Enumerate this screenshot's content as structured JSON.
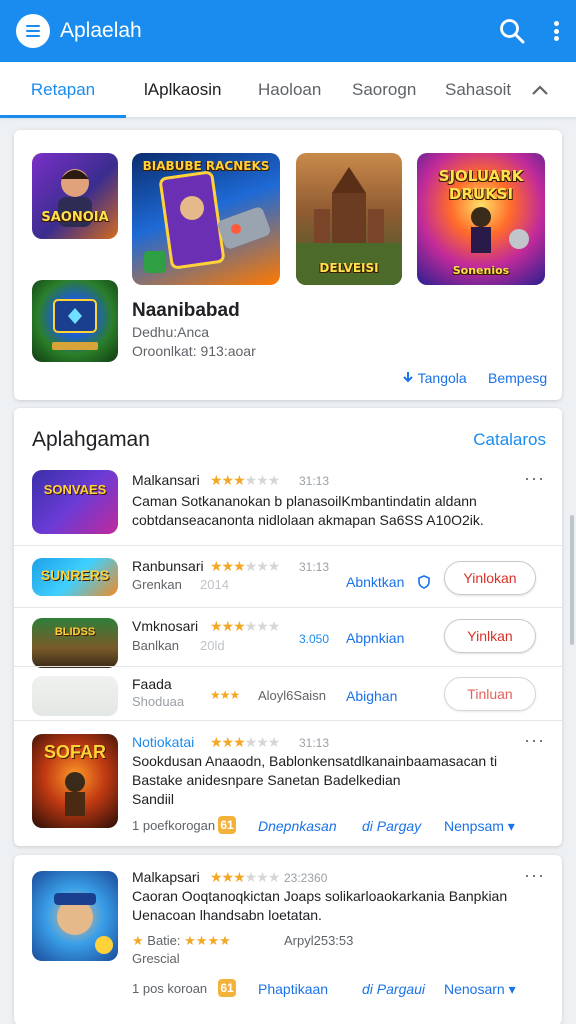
{
  "appbar": {
    "title": "Aplaelah",
    "icons": [
      "menu-icon",
      "search-icon",
      "more-vert-icon"
    ],
    "color": "#1a8cf0"
  },
  "tabs": [
    {
      "label": "Retapan",
      "active": true
    },
    {
      "label": "lAplkaosin"
    },
    {
      "label": "Haoloan"
    },
    {
      "label": "Saorogn"
    },
    {
      "label": "Sahasoit"
    }
  ],
  "featured": {
    "thumbs": [
      "SAONOIA",
      "BIABUBE RACNEKS",
      "DELVEISI",
      "SJOLUARK DRUKSI",
      ""
    ],
    "subcaption": "Sonenios",
    "title": "Naanibabad",
    "line1": "Dedhu:Anca",
    "line2": "Oroonlkat: 913:aoar",
    "link_left": "Tangola",
    "link_right": "Bempesg"
  },
  "section": {
    "title": "Aplahgaman",
    "link": "Catalaros",
    "items": [
      {
        "name": "Malkansari",
        "rating": "31:13",
        "stars": 3,
        "desc1": "Caman Sotkananokan b planasoilKmbantindatin aldann",
        "desc2": "cobtdanseacanonta nidlolaan akmapan Sa6SS A10O2ik.",
        "icon_text": "SONVAES"
      },
      {
        "name": "Ranbunsari",
        "rating": "31:13",
        "stars": 3,
        "meta": "Grenkan",
        "meta2": "2014",
        "link": "Abnktkan",
        "button": "Yinlokan",
        "icon_text": "SUNRERS"
      },
      {
        "name": "Vmknosari",
        "rating": "3.050",
        "stars": 3,
        "meta": "Banlkan",
        "meta2": "20ld",
        "link": "Abpnkian",
        "button": "Yinlkan",
        "icon_text": "BLIDSS"
      },
      {
        "name": "Faada",
        "stars": 3,
        "meta": "Shoduaa",
        "meta2": "Aloyl6Saisn",
        "link": "Abighan",
        "button": "Tinluan"
      },
      {
        "name": "Notiokatai",
        "rating": "31:13",
        "stars": 3,
        "desc1": "Sookdusan Anaaodn, Bablonkensatdlkanainbaamasacan ti",
        "desc2": "Bastake anidesnpare Sanetan Badelkedian",
        "desc3": "Sandiil",
        "meta": "1 poefkorogan",
        "badge": "61",
        "links": [
          "Dnepnkasan",
          "di Pargay",
          "Nenpsam"
        ],
        "icon_text": "SOFAR"
      }
    ]
  },
  "bottom_item": {
    "name": "Malkapsari",
    "rating": "23:2360",
    "stars": 3,
    "desc1": "Caoran Ooqtanoqkictan Joaps solikarloaokarkania Banpkian",
    "desc2": "Uenacoan lhandsabn loetatan.",
    "sub_label": "Batie:",
    "sub_value": "Arpyl253:53",
    "extra": "Grescial",
    "meta": "1 pos koroan",
    "badge": "61",
    "links": [
      "Phaptikaan",
      "di Pargaui",
      "Nenosarn"
    ]
  }
}
